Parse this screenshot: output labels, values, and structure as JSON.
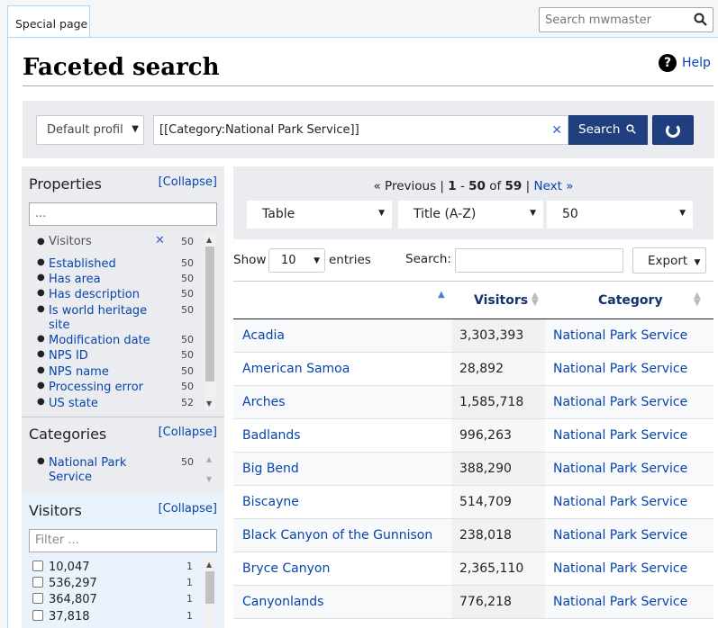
{
  "topbar": {
    "tab_label": "Special page",
    "search_placeholder": "Search mwmaster",
    "search_icon": "search-icon"
  },
  "header": {
    "title": "Faceted search",
    "help_label": "Help",
    "help_icon": "question-circle-icon"
  },
  "searchbar": {
    "profile": "Default profile",
    "query": "[[Category:National Park Service]]",
    "clear_icon": "clear-icon",
    "search_button": "Search",
    "refresh_icon": "refresh-icon",
    "accent": "#1f3f7f"
  },
  "sidebar": {
    "properties": {
      "title": "Properties",
      "collapse": "[Collapse]",
      "filter_value": "...",
      "items": [
        {
          "label": "Visitors",
          "count": "50",
          "selected": true
        },
        {
          "label": "Established",
          "count": "50"
        },
        {
          "label": "Has area",
          "count": "50"
        },
        {
          "label": "Has description",
          "count": "50"
        },
        {
          "label": "Is world heritage site",
          "count": "50"
        },
        {
          "label": "Modification date",
          "count": "50"
        },
        {
          "label": "NPS ID",
          "count": "50"
        },
        {
          "label": "NPS name",
          "count": "50"
        },
        {
          "label": "Processing error",
          "count": "50"
        },
        {
          "label": "US state",
          "count": "52"
        }
      ]
    },
    "categories": {
      "title": "Categories",
      "collapse": "[Collapse]",
      "items": [
        {
          "label": "National Park Service",
          "count": "50"
        }
      ]
    },
    "visitors": {
      "title": "Visitors",
      "collapse": "[Collapse]",
      "filter_placeholder": "Filter ...",
      "items": [
        {
          "label": "10,047",
          "count": "1"
        },
        {
          "label": "536,297",
          "count": "1"
        },
        {
          "label": "364,807",
          "count": "1"
        },
        {
          "label": "37,818",
          "count": "1"
        }
      ]
    }
  },
  "results": {
    "pager": {
      "prev": "« Previous",
      "sep1": " | ",
      "range_start": "1",
      "dash": " - ",
      "range_end": "50",
      "of": " of ",
      "total": "59",
      "sep2": " | ",
      "next": "Next »"
    },
    "format_select": "Table",
    "sort_select": "Title (A-Z)",
    "limit_select": "50",
    "show_label": "Show",
    "length_value": "10",
    "entries_label": "entries",
    "search_label": "Search:",
    "export_label": "Export",
    "columns": [
      "",
      "Visitors",
      "Category"
    ],
    "rows": [
      {
        "name": "Acadia",
        "visitors": "3,303,393",
        "category": "National Park Service"
      },
      {
        "name": "American Samoa",
        "visitors": "28,892",
        "category": "National Park Service"
      },
      {
        "name": "Arches",
        "visitors": "1,585,718",
        "category": "National Park Service"
      },
      {
        "name": "Badlands",
        "visitors": "996,263",
        "category": "National Park Service"
      },
      {
        "name": "Big Bend",
        "visitors": "388,290",
        "category": "National Park Service"
      },
      {
        "name": "Biscayne",
        "visitors": "514,709",
        "category": "National Park Service"
      },
      {
        "name": "Black Canyon of the Gunnison",
        "visitors": "238,018",
        "category": "National Park Service"
      },
      {
        "name": "Bryce Canyon",
        "visitors": "2,365,110",
        "category": "National Park Service"
      },
      {
        "name": "Canyonlands",
        "visitors": "776,218",
        "category": "National Park Service"
      }
    ]
  }
}
